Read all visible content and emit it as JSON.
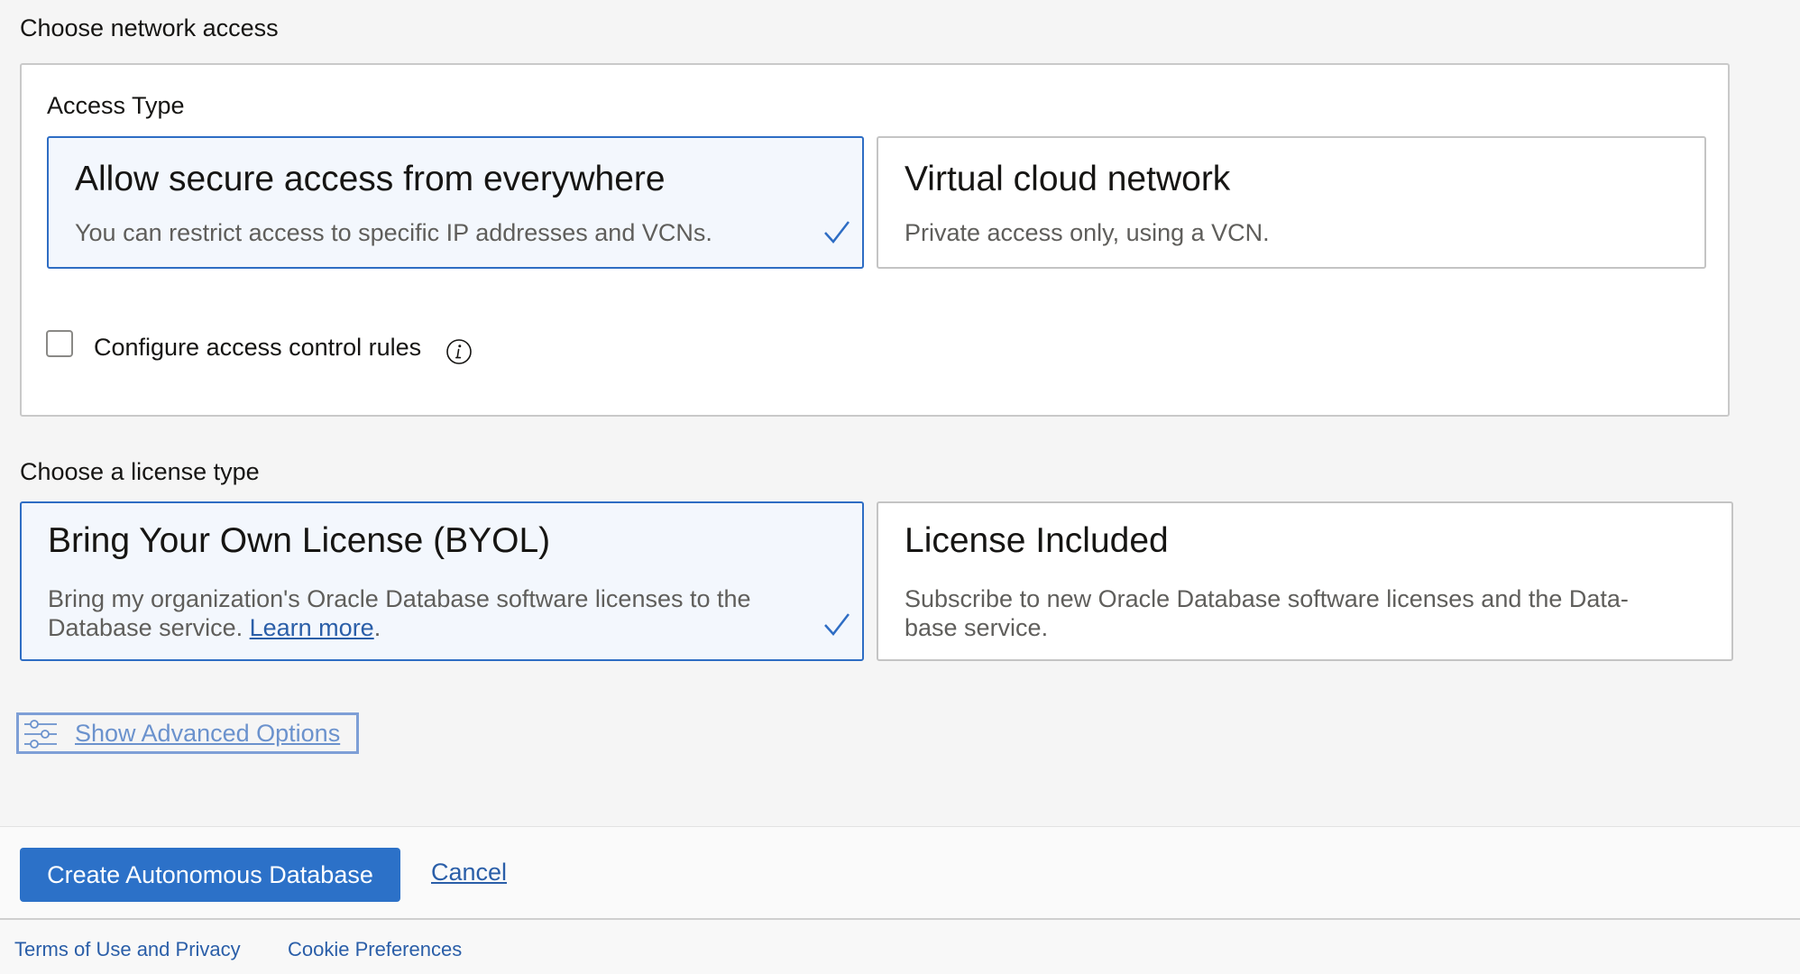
{
  "network": {
    "heading": "Choose network access",
    "access_type_label": "Access Type",
    "options": [
      {
        "title": "Allow secure access from everywhere",
        "description": "You can restrict access to specific IP addresses and VCNs.",
        "selected": true
      },
      {
        "title": "Virtual cloud network",
        "description": "Private access only, using a VCN.",
        "selected": false
      }
    ],
    "acl_checkbox_label": "Configure access control rules",
    "acl_checked": false
  },
  "license": {
    "heading": "Choose a license type",
    "options": [
      {
        "title": "Bring Your Own License (BYOL)",
        "description_before_link": "Bring my organization's Oracle Database software licenses to the Database service.",
        "link_text": "Learn more",
        "description_after_link": ".",
        "selected": true
      },
      {
        "title": "License Included",
        "description": "Subscribe to new Oracle Database software licenses and the Data-base service.",
        "selected": false
      }
    ]
  },
  "advanced": {
    "label": "Show Advanced Options",
    "icon": "sliders-icon"
  },
  "actions": {
    "primary_label": "Create Autonomous Database",
    "cancel_label": "Cancel"
  },
  "footer": {
    "links": [
      "Terms of Use and Privacy",
      "Cookie Preferences"
    ]
  },
  "colors": {
    "accent": "#2c71c8",
    "selected_border": "#2e6dc4",
    "selected_bg": "#f3f7fd",
    "link": "#2a5ea8"
  }
}
